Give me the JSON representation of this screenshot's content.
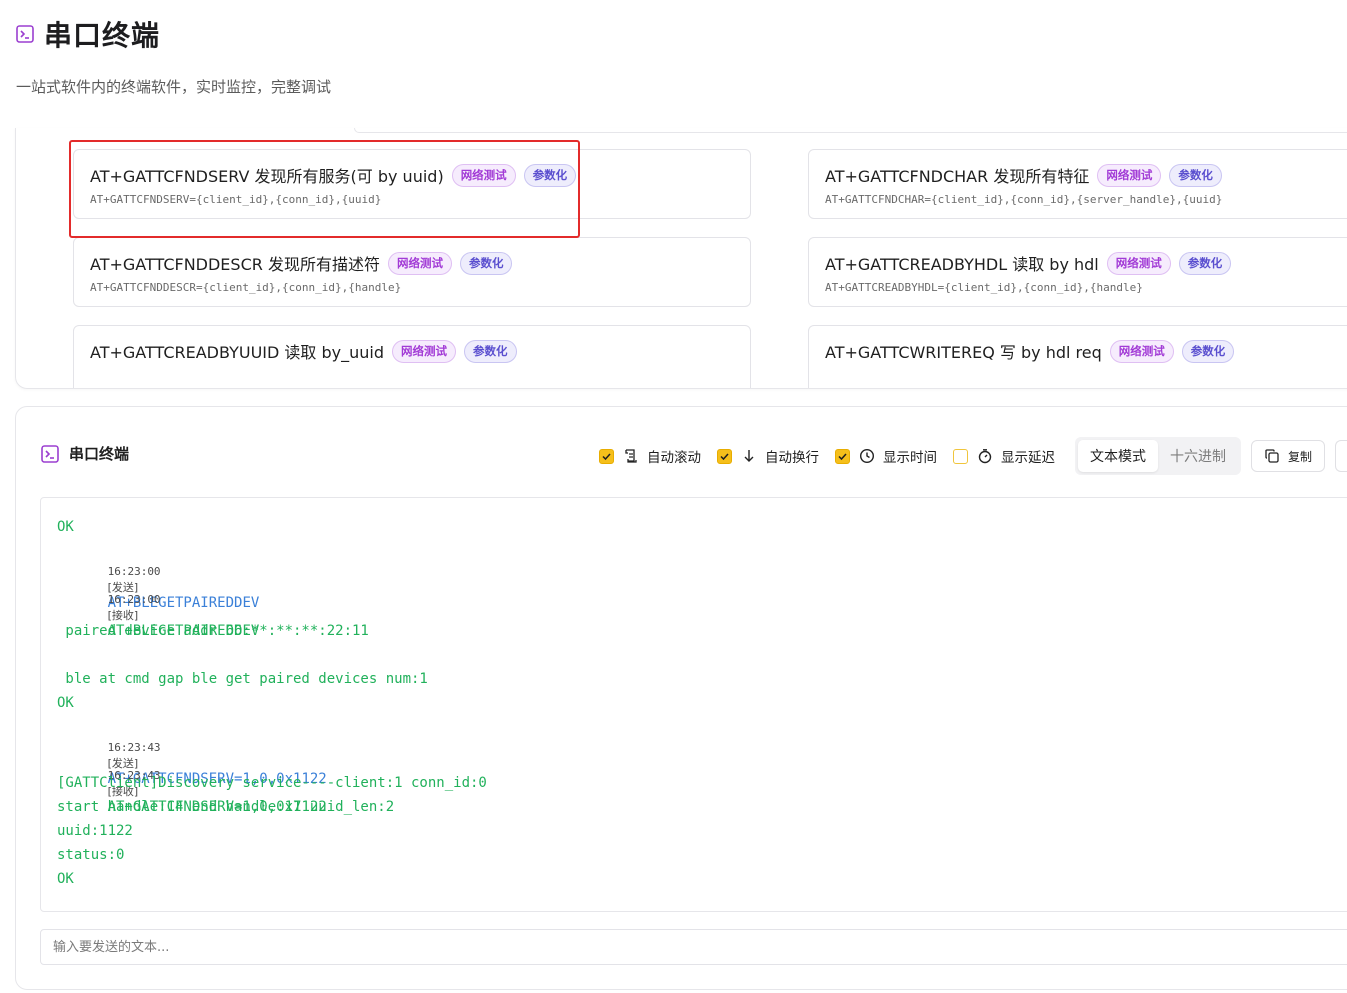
{
  "page": {
    "title": "串口终端",
    "subtitle": "一站式软件内的终端软件，实时监控，完整调试"
  },
  "colors": {
    "accent_purple": "#9b3fd0",
    "checkbox_yellow": "#f5bf1b",
    "output_green": "#21b15b",
    "output_blue": "#3b80d8",
    "highlight_red": "#e32b2b"
  },
  "commands": [
    {
      "name": "AT+GATTCFNDSERV 发现所有服务(可 by uuid)",
      "tags": [
        "网络测试",
        "参数化"
      ],
      "template": "AT+GATTCFNDSERV={client_id},{conn_id},{uuid}",
      "highlighted": true
    },
    {
      "name": "AT+GATTCFNDCHAR 发现所有特征",
      "tags": [
        "网络测试",
        "参数化"
      ],
      "template": "AT+GATTCFNDCHAR={client_id},{conn_id},{server_handle},{uuid}"
    },
    {
      "name": "AT+GATTCFNDDESCR 发现所有描述符",
      "tags": [
        "网络测试",
        "参数化"
      ],
      "template": "AT+GATTCFNDDESCR={client_id},{conn_id},{handle}"
    },
    {
      "name": "AT+GATTCREADBYHDL 读取 by hdl",
      "tags": [
        "网络测试",
        "参数化"
      ],
      "template": "AT+GATTCREADBYHDL={client_id},{conn_id},{handle}"
    },
    {
      "name": "AT+GATTCREADBYUUID 读取 by_uuid",
      "tags": [
        "网络测试",
        "参数化"
      ],
      "template": ""
    },
    {
      "name": "AT+GATTCWRITEREQ 写 by hdl req",
      "tags": [
        "网络测试",
        "参数化"
      ],
      "template": ""
    }
  ],
  "terminal": {
    "title": "串口终端",
    "options": [
      {
        "label": "自动滚动",
        "checked": true,
        "icon": "scroll-icon"
      },
      {
        "label": "自动换行",
        "checked": true,
        "icon": "arrow-down-icon"
      },
      {
        "label": "显示时间",
        "checked": true,
        "icon": "clock-icon"
      },
      {
        "label": "显示延迟",
        "checked": false,
        "icon": "timer-icon"
      }
    ],
    "modes": {
      "text": "文本模式",
      "hex": "十六进制",
      "active": "text"
    },
    "copy_label": "复制",
    "input_placeholder": "输入要发送的文本...",
    "output": [
      {
        "text": "OK",
        "color": "green"
      },
      {
        "time": "16:23:00",
        "dir": "[发送]",
        "text": "AT+BLEGETPAIREDDEV",
        "color": "blue"
      },
      {
        "time": "16:23:00",
        "dir": "[接收]",
        "text": "AT+BLEGETPAIREDDEV",
        "color": "green"
      },
      {
        "text": " paired device addr 66:**:**:**:22:11",
        "color": "green"
      },
      {
        "text": " ble at cmd gap ble get paired devices num:1",
        "color": "green"
      },
      {
        "text": "OK",
        "color": "green"
      },
      {
        "time": "16:23:43",
        "dir": "[发送]",
        "text": "AT+GATTCFNDSERV=1,0,0x1122",
        "color": "blue"
      },
      {
        "time": "16:23:43",
        "dir": "[接收]",
        "text": "AT+GATTCFNDSERV=1,0,0x1122",
        "color": "green"
      },
      {
        "text": "[GATTClient]Discovery service----client:1 conn_id:0",
        "color": "green"
      },
      {
        "text": "start handle:14 end handle:17 uuid_len:2",
        "color": "green"
      },
      {
        "text": "uuid:1122",
        "color": "green"
      },
      {
        "text": "status:0",
        "color": "green"
      },
      {
        "text": "OK",
        "color": "green"
      }
    ]
  }
}
